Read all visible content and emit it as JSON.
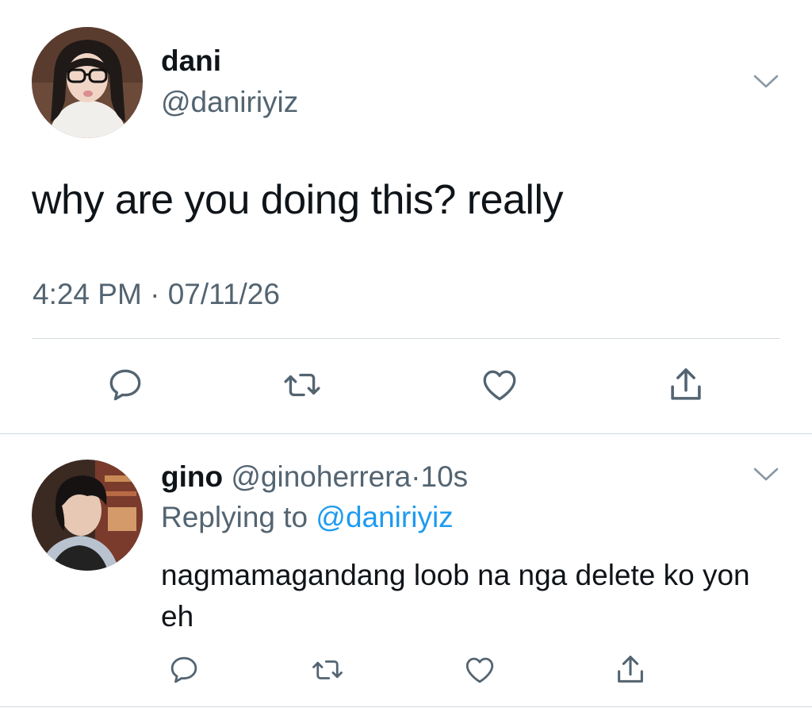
{
  "main_tweet": {
    "author_name": "dani",
    "author_handle": "@daniriyiz",
    "text": "why are you doing this? really",
    "time": "4:24 PM",
    "separator": "·",
    "date": "07/11/26",
    "icons": [
      "reply-icon",
      "retweet-icon",
      "like-icon",
      "share-icon"
    ]
  },
  "reply_tweet": {
    "author_name": "gino",
    "author_handle": "@ginoherrera",
    "separator": "·",
    "time": "10s",
    "replying_prefix": "Replying to",
    "replying_handle": "@daniriyiz",
    "text": "nagmamagandang loob na nga delete ko yon eh",
    "icons": [
      "reply-icon",
      "retweet-icon",
      "like-icon",
      "share-icon"
    ]
  },
  "colors": {
    "text_primary": "#0f1419",
    "text_secondary": "#536471",
    "link": "#1d9bf0",
    "divider": "#cfd9de"
  }
}
